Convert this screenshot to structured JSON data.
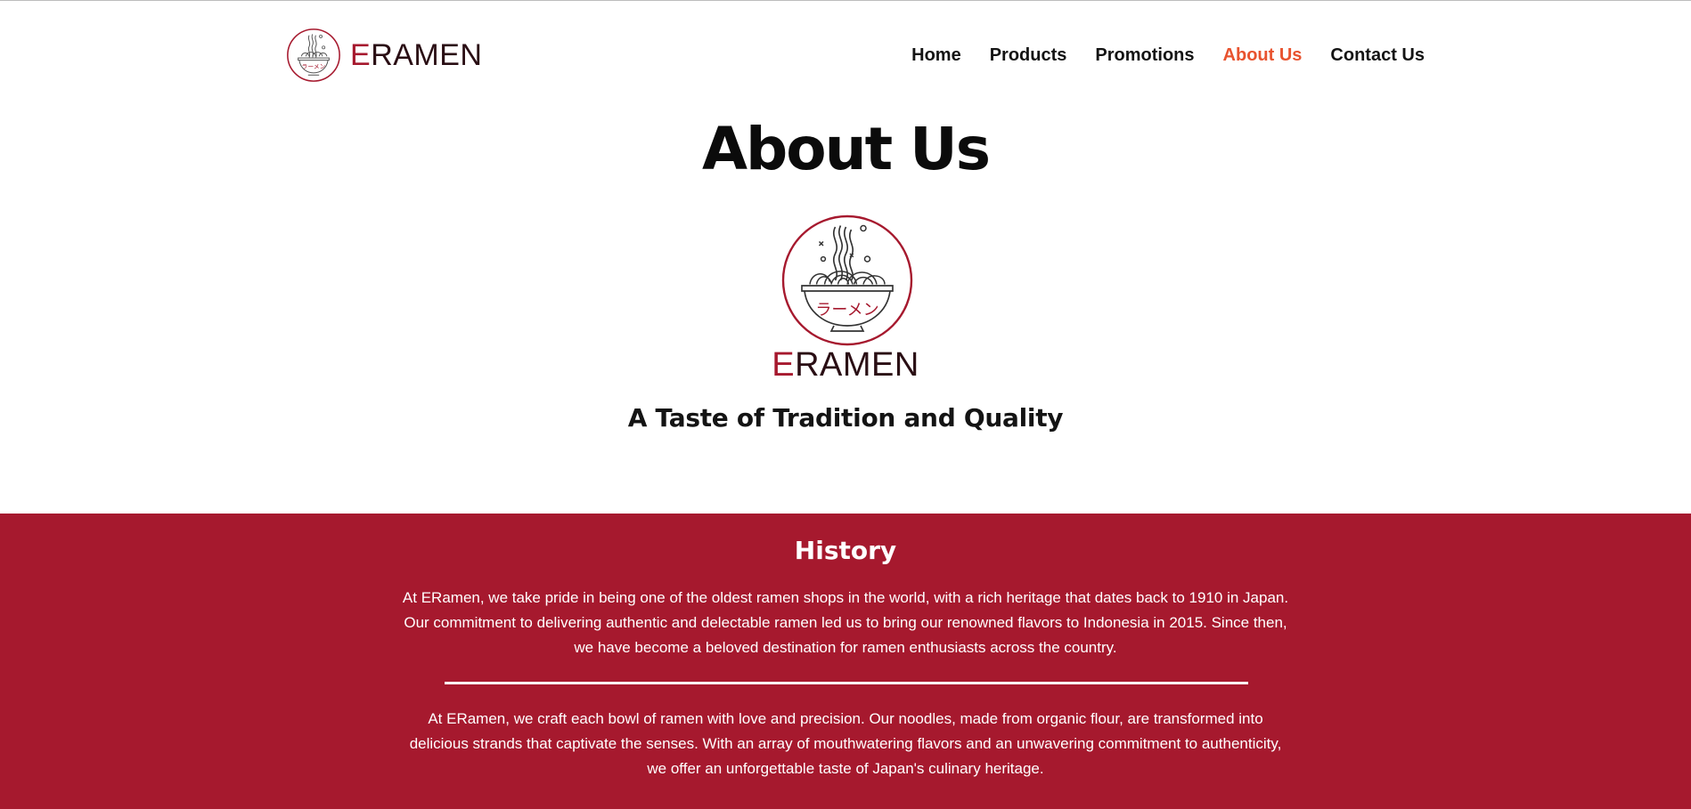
{
  "brand": {
    "word_initial": "E",
    "word_rest": "RAMEN",
    "logo_script": "ラーメン",
    "color_accent": "#a6192e",
    "color_dark": "#2a0e14"
  },
  "nav": {
    "items": [
      {
        "label": "Home",
        "active": false
      },
      {
        "label": "Products",
        "active": false
      },
      {
        "label": "Promotions",
        "active": false
      },
      {
        "label": "About Us",
        "active": true
      },
      {
        "label": "Contact Us",
        "active": false
      }
    ],
    "active_color": "#e8532f"
  },
  "hero": {
    "title": "About Us",
    "tagline": "A Taste of Tradition and Quality"
  },
  "history": {
    "title": "History",
    "background": "#a6192e",
    "paragraph1": "At ERamen, we take pride in being one of the oldest ramen shops in the world, with a rich heritage that dates back to 1910 in Japan. Our commitment to delivering authentic and delectable ramen led us to bring our renowned flavors to Indonesia in 2015. Since then, we have become a beloved destination for ramen enthusiasts across the country.",
    "paragraph2": "At ERamen, we craft each bowl of ramen with love and precision. Our noodles, made from organic flour, are transformed into delicious strands that captivate the senses. With an array of mouthwatering flavors and an unwavering commitment to authenticity, we offer an unforgettable taste of Japan's culinary heritage."
  }
}
